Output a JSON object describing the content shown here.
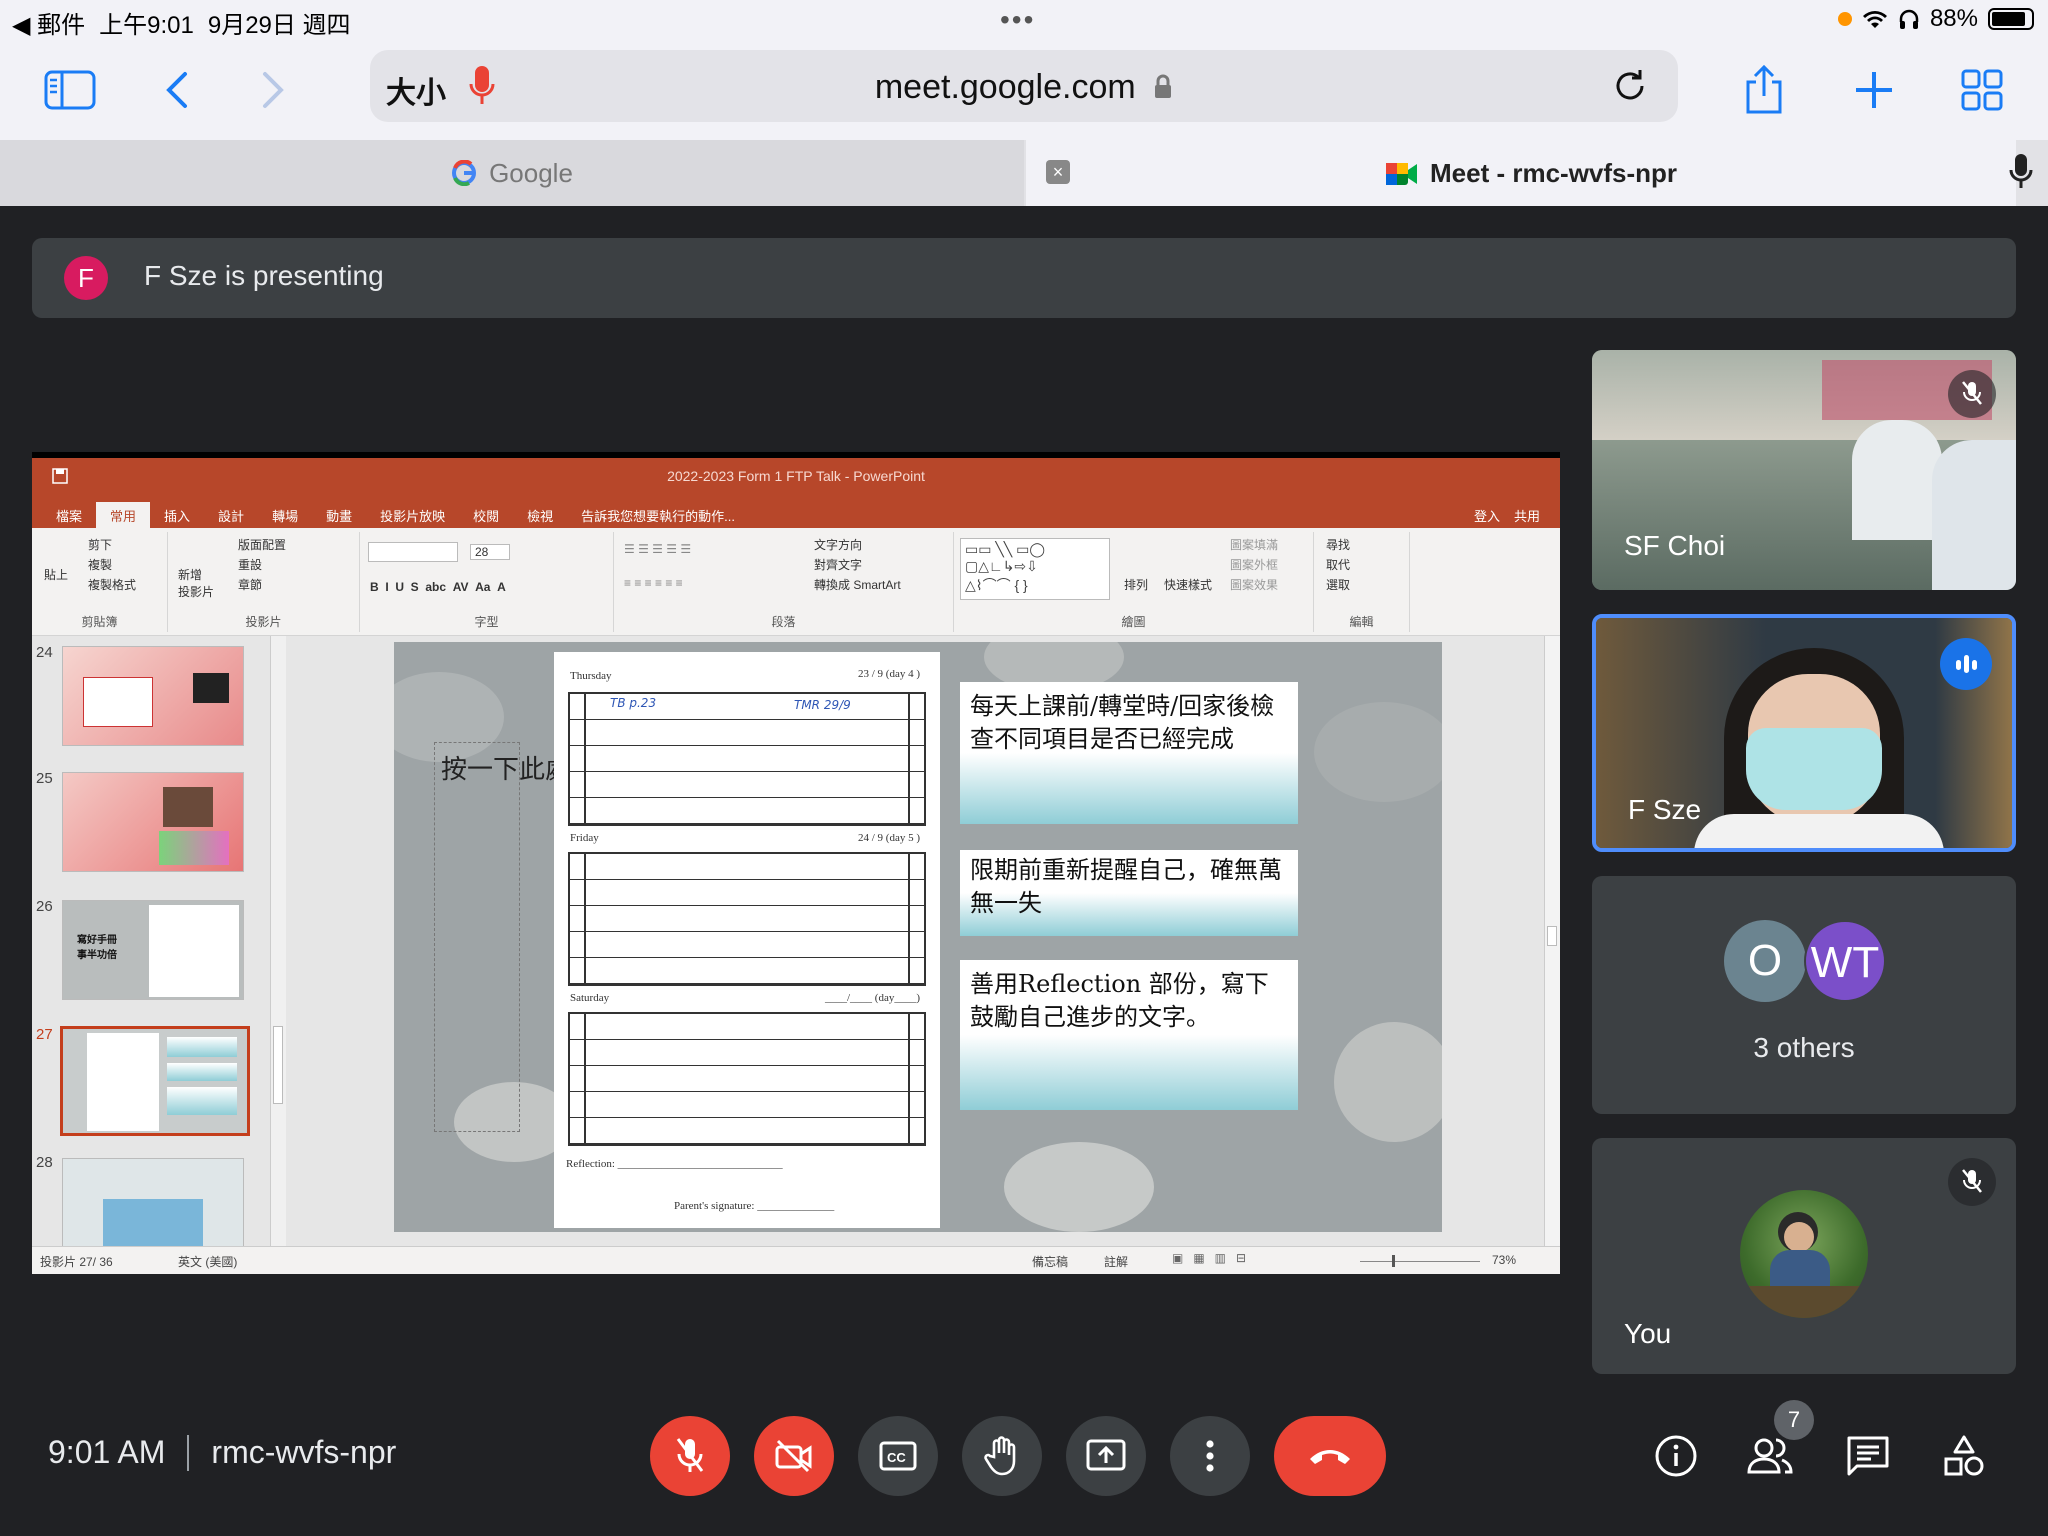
{
  "status_bar": {
    "back_app": "◀ 郵件",
    "time": "上午9:01",
    "date": "9月29日 週四",
    "dots": "•••",
    "battery": "88%"
  },
  "browser": {
    "text_size": "大小",
    "url": "meet.google.com",
    "tabs": [
      {
        "title": "Google"
      },
      {
        "title": "Meet - rmc-wvfs-npr"
      }
    ]
  },
  "banner": {
    "avatar_letter": "F",
    "text": "F Sze is presenting"
  },
  "ppt": {
    "window_title": "2022-2023 Form 1 FTP Talk - PowerPoint",
    "tabs": [
      "檔案",
      "常用",
      "插入",
      "設計",
      "轉場",
      "動畫",
      "投影片放映",
      "校閱",
      "檢視",
      "告訴我您想要執行的動作..."
    ],
    "login": "登入",
    "share": "共用",
    "ribbon": {
      "clipboard": {
        "paste": "貼上",
        "cut": "剪下",
        "copy": "複製",
        "format_painter": "複製格式",
        "label": "剪貼簿"
      },
      "slides": {
        "new_slide": "新增\n投影片",
        "layout": "版面配置",
        "reset": "重設",
        "section": "章節",
        "label": "投影片"
      },
      "font": {
        "size": "28",
        "label": "字型"
      },
      "paragraph": {
        "text_direction": "文字方向",
        "align_text": "對齊文字",
        "smartart": "轉換成 SmartArt",
        "label": "段落"
      },
      "drawing": {
        "arrange": "排列",
        "quick_styles": "快速樣式",
        "shape_fill": "圖案填滿",
        "shape_outline": "圖案外框",
        "shape_effects": "圖案效果",
        "label": "繪圖"
      },
      "editing": {
        "find": "尋找",
        "replace": "取代",
        "select": "選取",
        "label": "編輯"
      }
    },
    "thumb_numbers": [
      "24",
      "25",
      "26",
      "27",
      "28"
    ],
    "thumb_texts": {
      "26": "寫好手冊\n事半功倍"
    },
    "slide": {
      "press_text": "按一下此處",
      "planner": {
        "thursday": "Thursday",
        "friday": "Friday",
        "saturday": "Saturday",
        "thu_date": "23 / 9   (day 4 )",
        "fri_date": "24 / 9   (day 5 )",
        "sat_date": "____/____  (day____)",
        "hw1": "TB p.23",
        "hw2": "TMR  29/9",
        "reflection": "Reflection: ______________________________",
        "signature": "Parent's signature: ______________"
      },
      "callouts": [
        "每天上課前/轉堂時/回家後檢查不同項目是否已經完成",
        "限期前重新提醒自己，確無萬無一失",
        "善用Reflection 部份，寫下鼓勵自己進步的文字。"
      ]
    },
    "status": {
      "slide_count": "投影片 27/ 36",
      "language": "英文 (美國)",
      "notes": "備忘稿",
      "comments": "註解",
      "zoom": "73%"
    }
  },
  "participants": [
    {
      "name": "SF Choi",
      "muted": true
    },
    {
      "name": "F Sze",
      "speaking": true
    },
    {
      "others_label": "3 others",
      "initials": [
        "O",
        "WT"
      ],
      "colors": [
        "#6b8490",
        "#7b4fc9"
      ]
    },
    {
      "name": "You",
      "muted": true
    }
  ],
  "meeting": {
    "time": "9:01 AM",
    "code": "rmc-wvfs-npr",
    "people_count": "7"
  },
  "colors": {
    "meet_bg": "#202124",
    "tile_bg": "#3c4043",
    "end_red": "#ea4335",
    "accent_blue": "#1a73e8",
    "ppt_orange": "#b7472a"
  }
}
